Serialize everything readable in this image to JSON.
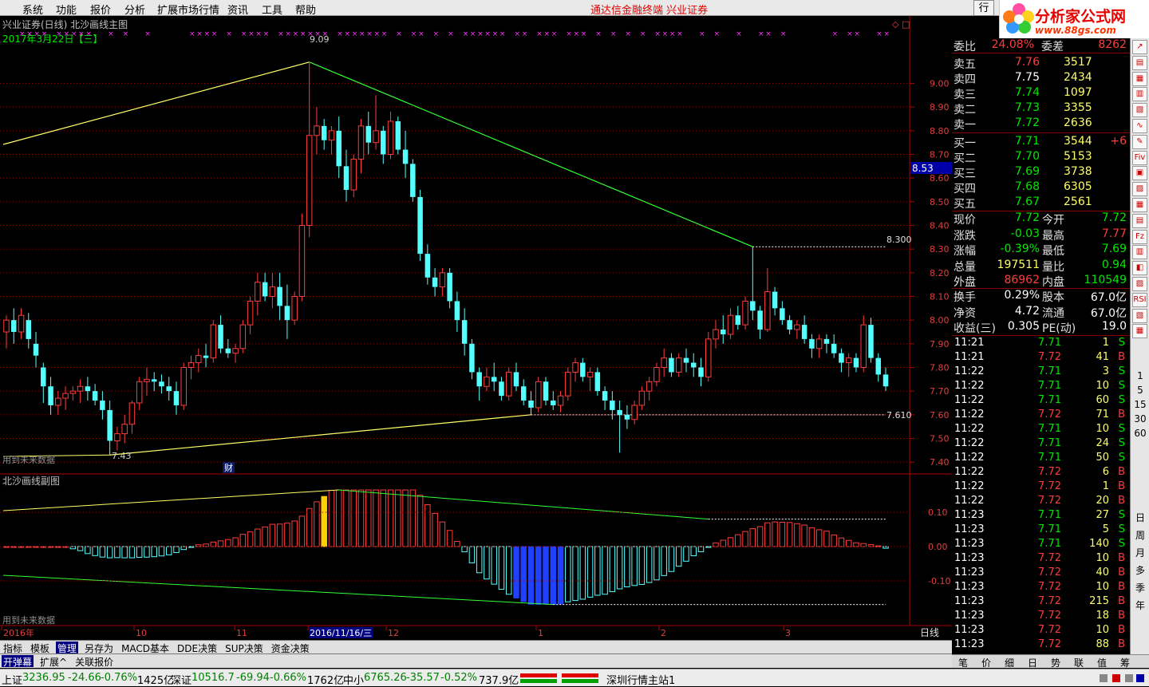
{
  "menu": [
    "系统",
    "功能",
    "报价",
    "分析",
    "扩展市场行情",
    "资讯",
    "工具",
    "帮助"
  ],
  "center_title": "通达信金融终端   兴业证券",
  "right_tab": "行",
  "logo": {
    "name": "分析家公式网",
    "url": "www.88gs.com"
  },
  "main_panel": {
    "title": "兴业证券(日线) 北沙画线主图",
    "date": "2017年3月22日【三】",
    "price_axis": [
      "9.00",
      "8.90",
      "8.80",
      "8.70",
      "8.60",
      "8.50",
      "8.40",
      "8.30",
      "8.20",
      "8.10",
      "8.00",
      "7.90",
      "7.80",
      "7.70",
      "7.60",
      "7.50",
      "7.40"
    ],
    "current_price_label": "8.53",
    "annotations": {
      "high": "9.09",
      "low": "7.43",
      "right_high": "8.300",
      "right_low": "7.610"
    },
    "future_data_note": "用到未来数据",
    "fin_marker": "财"
  },
  "sub_panel": {
    "title": "北沙画线副图",
    "axis": [
      "0.10",
      "0.00",
      "-0.10"
    ],
    "future_data_note": "用到未来数据"
  },
  "time_axis": {
    "labels": [
      "2016年",
      "10",
      "11",
      "2016/11/16/三",
      "12",
      "1",
      "2",
      "3"
    ],
    "period": "日线"
  },
  "chart_data": {
    "type": "candlestick",
    "title": "兴业证券(日线) 北沙画线主图",
    "ylim": [
      7.35,
      9.15
    ],
    "high": 9.09,
    "low": 7.43,
    "ohlc": [
      [
        7.95,
        8.02,
        7.88,
        8.0
      ],
      [
        8.0,
        8.05,
        7.9,
        7.95
      ],
      [
        7.95,
        8.05,
        7.92,
        8.02
      ],
      [
        8.0,
        8.03,
        7.88,
        7.92
      ],
      [
        7.9,
        7.95,
        7.8,
        7.85
      ],
      [
        7.8,
        7.82,
        7.65,
        7.72
      ],
      [
        7.72,
        7.76,
        7.6,
        7.64
      ],
      [
        7.64,
        7.7,
        7.6,
        7.67
      ],
      [
        7.67,
        7.72,
        7.62,
        7.69
      ],
      [
        7.69,
        7.72,
        7.66,
        7.7
      ],
      [
        7.7,
        7.75,
        7.65,
        7.72
      ],
      [
        7.72,
        7.76,
        7.66,
        7.7
      ],
      [
        7.7,
        7.73,
        7.64,
        7.66
      ],
      [
        7.66,
        7.7,
        7.58,
        7.62
      ],
      [
        7.62,
        7.66,
        7.43,
        7.49
      ],
      [
        7.49,
        7.55,
        7.45,
        7.52
      ],
      [
        7.52,
        7.6,
        7.48,
        7.56
      ],
      [
        7.56,
        7.66,
        7.52,
        7.65
      ],
      [
        7.65,
        7.76,
        7.62,
        7.74
      ],
      [
        7.74,
        7.8,
        7.68,
        7.75
      ],
      [
        7.75,
        7.78,
        7.7,
        7.74
      ],
      [
        7.74,
        7.77,
        7.69,
        7.72
      ],
      [
        7.72,
        7.76,
        7.66,
        7.7
      ],
      [
        7.7,
        7.74,
        7.6,
        7.64
      ],
      [
        7.64,
        7.82,
        7.62,
        7.8
      ],
      [
        7.8,
        7.85,
        7.75,
        7.82
      ],
      [
        7.82,
        7.88,
        7.78,
        7.85
      ],
      [
        7.85,
        7.9,
        7.8,
        7.84
      ],
      [
        7.84,
        8.0,
        7.82,
        7.98
      ],
      [
        7.98,
        8.02,
        7.86,
        7.88
      ],
      [
        7.88,
        7.92,
        7.84,
        7.86
      ],
      [
        7.86,
        7.9,
        7.82,
        7.88
      ],
      [
        7.88,
        8.0,
        7.86,
        7.98
      ],
      [
        7.98,
        8.1,
        7.94,
        8.08
      ],
      [
        8.08,
        8.2,
        8.02,
        8.16
      ],
      [
        8.16,
        8.2,
        8.08,
        8.1
      ],
      [
        8.1,
        8.2,
        8.05,
        8.14
      ],
      [
        8.14,
        8.2,
        8.0,
        8.06
      ],
      [
        8.06,
        8.15,
        7.92,
        8.0
      ],
      [
        8.0,
        8.12,
        7.98,
        8.1
      ],
      [
        8.1,
        8.45,
        8.08,
        8.4
      ],
      [
        8.4,
        9.09,
        8.35,
        8.78
      ],
      [
        8.78,
        8.9,
        8.7,
        8.82
      ],
      [
        8.82,
        8.85,
        8.72,
        8.76
      ],
      [
        8.76,
        8.82,
        8.7,
        8.8
      ],
      [
        8.8,
        8.86,
        8.6,
        8.65
      ],
      [
        8.65,
        8.72,
        8.5,
        8.55
      ],
      [
        8.55,
        8.7,
        8.52,
        8.68
      ],
      [
        8.68,
        8.85,
        8.62,
        8.82
      ],
      [
        8.82,
        8.88,
        8.7,
        8.75
      ],
      [
        8.75,
        8.95,
        8.72,
        8.8
      ],
      [
        8.8,
        8.82,
        8.66,
        8.7
      ],
      [
        8.7,
        8.88,
        8.68,
        8.84
      ],
      [
        8.84,
        8.86,
        8.7,
        8.72
      ],
      [
        8.72,
        8.8,
        8.6,
        8.66
      ],
      [
        8.66,
        8.68,
        8.5,
        8.52
      ],
      [
        8.52,
        8.55,
        8.25,
        8.28
      ],
      [
        8.28,
        8.32,
        8.15,
        8.18
      ],
      [
        8.18,
        8.22,
        8.1,
        8.14
      ],
      [
        8.14,
        8.22,
        8.1,
        8.2
      ],
      [
        8.2,
        8.22,
        8.05,
        8.08
      ],
      [
        8.08,
        8.12,
        7.95,
        8.0
      ],
      [
        8.0,
        8.05,
        7.85,
        7.9
      ],
      [
        7.9,
        7.92,
        7.75,
        7.78
      ],
      [
        7.78,
        7.8,
        7.66,
        7.72
      ],
      [
        7.72,
        7.8,
        7.7,
        7.76
      ],
      [
        7.76,
        7.82,
        7.7,
        7.74
      ],
      [
        7.74,
        7.76,
        7.66,
        7.68
      ],
      [
        7.68,
        7.8,
        7.66,
        7.78
      ],
      [
        7.78,
        7.82,
        7.7,
        7.72
      ],
      [
        7.72,
        7.75,
        7.64,
        7.66
      ],
      [
        7.66,
        7.7,
        7.6,
        7.63
      ],
      [
        7.63,
        7.76,
        7.61,
        7.74
      ],
      [
        7.74,
        7.76,
        7.64,
        7.66
      ],
      [
        7.66,
        7.7,
        7.62,
        7.64
      ],
      [
        7.64,
        7.7,
        7.61,
        7.68
      ],
      [
        7.68,
        7.8,
        7.66,
        7.78
      ],
      [
        7.78,
        7.84,
        7.74,
        7.82
      ],
      [
        7.82,
        7.84,
        7.74,
        7.76
      ],
      [
        7.76,
        7.8,
        7.7,
        7.78
      ],
      [
        7.78,
        7.8,
        7.68,
        7.7
      ],
      [
        7.7,
        7.72,
        7.62,
        7.66
      ],
      [
        7.66,
        7.7,
        7.58,
        7.62
      ],
      [
        7.62,
        7.66,
        7.44,
        7.6
      ],
      [
        7.6,
        7.64,
        7.54,
        7.58
      ],
      [
        7.58,
        7.66,
        7.56,
        7.64
      ],
      [
        7.64,
        7.72,
        7.62,
        7.7
      ],
      [
        7.7,
        7.76,
        7.66,
        7.74
      ],
      [
        7.74,
        7.82,
        7.72,
        7.8
      ],
      [
        7.8,
        7.88,
        7.76,
        7.84
      ],
      [
        7.84,
        7.86,
        7.76,
        7.78
      ],
      [
        7.78,
        7.86,
        7.76,
        7.84
      ],
      [
        7.84,
        7.88,
        7.78,
        7.82
      ],
      [
        7.82,
        7.86,
        7.76,
        7.8
      ],
      [
        7.8,
        7.84,
        7.72,
        7.76
      ],
      [
        7.76,
        7.95,
        7.74,
        7.92
      ],
      [
        7.92,
        8.0,
        7.88,
        7.96
      ],
      [
        7.96,
        8.02,
        7.9,
        7.94
      ],
      [
        7.94,
        8.05,
        7.92,
        8.02
      ],
      [
        8.02,
        8.06,
        7.96,
        7.98
      ],
      [
        7.98,
        8.1,
        7.96,
        8.08
      ],
      [
        8.08,
        8.31,
        8.0,
        8.04
      ],
      [
        8.04,
        8.06,
        7.92,
        7.96
      ],
      [
        7.96,
        8.22,
        7.95,
        8.12
      ],
      [
        8.12,
        8.14,
        8.02,
        8.05
      ],
      [
        8.05,
        8.08,
        7.98,
        8.0
      ],
      [
        8.0,
        8.02,
        7.94,
        7.96
      ],
      [
        7.96,
        8.0,
        7.92,
        7.98
      ],
      [
        7.98,
        8.02,
        7.9,
        7.92
      ],
      [
        7.92,
        7.94,
        7.84,
        7.88
      ],
      [
        7.88,
        7.94,
        7.84,
        7.92
      ],
      [
        7.92,
        7.94,
        7.86,
        7.9
      ],
      [
        7.9,
        7.94,
        7.84,
        7.86
      ],
      [
        7.86,
        7.88,
        7.78,
        7.82
      ],
      [
        7.82,
        7.86,
        7.76,
        7.84
      ],
      [
        7.84,
        7.86,
        7.78,
        7.8
      ],
      [
        7.8,
        8.02,
        7.78,
        7.98
      ],
      [
        7.98,
        8.01,
        7.82,
        7.84
      ],
      [
        7.84,
        7.86,
        7.74,
        7.77
      ],
      [
        7.77,
        7.8,
        7.7,
        7.72
      ]
    ]
  },
  "quote": {
    "ratio_row": {
      "l1": "委比",
      "v1": "24.08%",
      "l2": "委差",
      "v2": "8262"
    },
    "asks": [
      {
        "label": "卖五",
        "price": "7.76",
        "vol": "3517"
      },
      {
        "label": "卖四",
        "price": "7.75",
        "vol": "2434"
      },
      {
        "label": "卖三",
        "price": "7.74",
        "vol": "1097"
      },
      {
        "label": "卖二",
        "price": "7.73",
        "vol": "3355"
      },
      {
        "label": "卖一",
        "price": "7.72",
        "vol": "2636"
      }
    ],
    "bids": [
      {
        "label": "买一",
        "price": "7.71",
        "vol": "3544",
        "extra": "+6"
      },
      {
        "label": "买二",
        "price": "7.70",
        "vol": "5153",
        "extra": ""
      },
      {
        "label": "买三",
        "price": "7.69",
        "vol": "3738",
        "extra": ""
      },
      {
        "label": "买四",
        "price": "7.68",
        "vol": "6305",
        "extra": ""
      },
      {
        "label": "买五",
        "price": "7.67",
        "vol": "2561",
        "extra": ""
      }
    ],
    "stats": [
      {
        "l1": "现价",
        "v1": "7.72",
        "l2": "今开",
        "v2": "7.72"
      },
      {
        "l1": "涨跌",
        "v1": "-0.03",
        "l2": "最高",
        "v2": "7.77"
      },
      {
        "l1": "涨幅",
        "v1": "-0.39%",
        "l2": "最低",
        "v2": "7.69"
      },
      {
        "l1": "总量",
        "v1": "197511",
        "l2": "量比",
        "v2": "0.94"
      },
      {
        "l1": "外盘",
        "v1": "86962",
        "l2": "内盘",
        "v2": "110549"
      }
    ],
    "fund": [
      {
        "l1": "换手",
        "v1": "0.29%",
        "l2": "股本",
        "v2": "67.0亿"
      },
      {
        "l1": "净资",
        "v1": "4.72",
        "l2": "流通",
        "v2": "67.0亿"
      },
      {
        "l1": "收益(三)",
        "v1": "0.305",
        "l2": "PE(动)",
        "v2": "19.0"
      }
    ],
    "ticks": [
      {
        "t": "11:21",
        "p": "7.71",
        "v": "1",
        "bs": "S"
      },
      {
        "t": "11:21",
        "p": "7.72",
        "v": "41",
        "bs": "B"
      },
      {
        "t": "11:22",
        "p": "7.71",
        "v": "3",
        "bs": "S"
      },
      {
        "t": "11:22",
        "p": "7.71",
        "v": "10",
        "bs": "S"
      },
      {
        "t": "11:22",
        "p": "7.71",
        "v": "60",
        "bs": "S"
      },
      {
        "t": "11:22",
        "p": "7.72",
        "v": "71",
        "bs": "B"
      },
      {
        "t": "11:22",
        "p": "7.71",
        "v": "10",
        "bs": "S"
      },
      {
        "t": "11:22",
        "p": "7.71",
        "v": "24",
        "bs": "S"
      },
      {
        "t": "11:22",
        "p": "7.71",
        "v": "50",
        "bs": "S"
      },
      {
        "t": "11:22",
        "p": "7.72",
        "v": "6",
        "bs": "B"
      },
      {
        "t": "11:22",
        "p": "7.72",
        "v": "1",
        "bs": "B"
      },
      {
        "t": "11:22",
        "p": "7.72",
        "v": "20",
        "bs": "B"
      },
      {
        "t": "11:23",
        "p": "7.71",
        "v": "27",
        "bs": "S"
      },
      {
        "t": "11:23",
        "p": "7.71",
        "v": "5",
        "bs": "S"
      },
      {
        "t": "11:23",
        "p": "7.71",
        "v": "140",
        "bs": "S"
      },
      {
        "t": "11:23",
        "p": "7.72",
        "v": "10",
        "bs": "B"
      },
      {
        "t": "11:23",
        "p": "7.72",
        "v": "40",
        "bs": "B"
      },
      {
        "t": "11:23",
        "p": "7.72",
        "v": "10",
        "bs": "B"
      },
      {
        "t": "11:23",
        "p": "7.72",
        "v": "215",
        "bs": "B"
      },
      {
        "t": "11:23",
        "p": "7.72",
        "v": "18",
        "bs": "B"
      },
      {
        "t": "11:23",
        "p": "7.72",
        "v": "10",
        "bs": "B"
      },
      {
        "t": "11:23",
        "p": "7.72",
        "v": "88",
        "bs": "B"
      }
    ]
  },
  "quote_tabs": [
    "笔",
    "价",
    "细",
    "日",
    "势",
    "联",
    "值",
    "筹"
  ],
  "side_toolbar": [
    "日",
    "周",
    "月",
    "多",
    "季",
    "年"
  ],
  "side_minutes": [
    "1",
    "5",
    "15",
    "30",
    "60"
  ],
  "bottom_tabs1": [
    "指标",
    "模板",
    "管理",
    "另存为",
    "MACD基本",
    "DDE决策",
    "SUP决策",
    "资金决策"
  ],
  "bottom_tabs2": [
    "开弹幕",
    "扩展^",
    "关联报价"
  ],
  "status": {
    "sh_label": "上证",
    "sh_val": "3236.95",
    "sh_chg": "-24.66",
    "sh_pct": "-0.76%",
    "sh_amt": "1425亿",
    "sz_label": "深证",
    "sz_val": "10516.7",
    "sz_chg": "-69.94",
    "sz_pct": "-0.66%",
    "sz_amt": "1762亿",
    "zx_label": "中小",
    "zx_val": "6765.26",
    "zx_chg": "-35.57",
    "zx_pct": "-0.52%",
    "zx_amt": "737.9亿",
    "station": "深圳行情主站1"
  },
  "colors": {
    "up": "#ff3c3c",
    "down": "#54ffff",
    "text_cyan": "#5de4f0",
    "green": "#00e800",
    "grid": "#8a0000",
    "magenta": "#ff33ff",
    "yellow": "#ffff66",
    "line_green": "#33ff33"
  }
}
